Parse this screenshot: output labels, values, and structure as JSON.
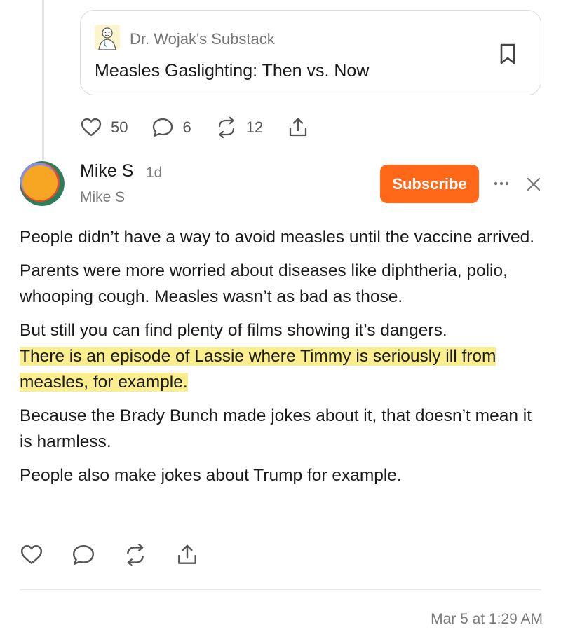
{
  "embed": {
    "publication": "Dr. Wojak's Substack",
    "title": "Measles Gaslighting: Then vs. Now",
    "logo_icon": "doctor-avatar-logo",
    "bookmark_icon": "bookmark-icon"
  },
  "post_actions": {
    "likes": "50",
    "comments": "6",
    "restacks": "12"
  },
  "comment": {
    "author": "Mike S",
    "time": "1d",
    "handle": "Mike S",
    "subscribe_label": "Subscribe",
    "subscribe_color": "#ff6719",
    "paragraphs": [
      "People didn’t have a way to avoid measles until the vaccine arrived.",
      "Parents were more worried about diseases like diphtheria, polio, whooping cough. Measles wasn’t as bad as those.",
      "But still you can find plenty of films showing it’s dangers.",
      "There is an episode of Lassie where Timmy is seriously ill from measles, for example.",
      "Because the Brady Bunch made jokes about it, that doesn’t mean it is harmless.",
      "People also make jokes about Trump for example."
    ],
    "highlight_color": "#fbee8f",
    "timestamp": "Mar 5 at 1:29 AM"
  }
}
